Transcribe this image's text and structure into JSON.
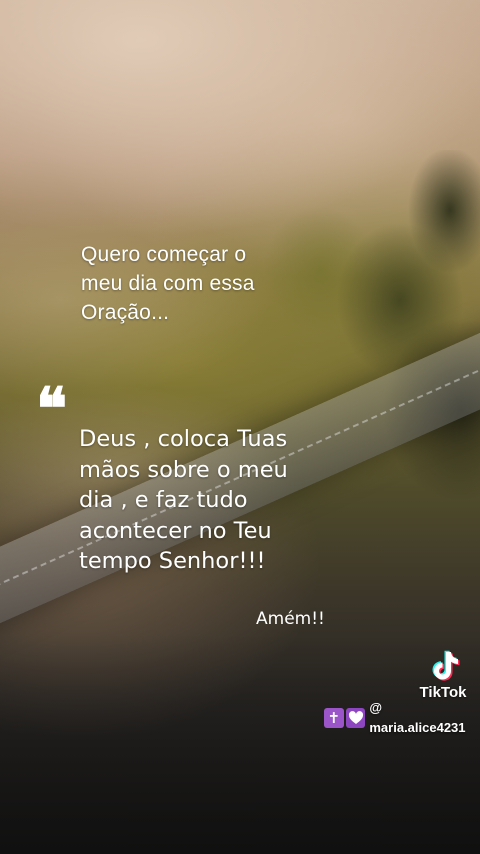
{
  "post": {
    "intro_text": "Quero começar o\nmeu dia com essa\nOração...",
    "quote_mark": "❝",
    "prayer_text": "Deus , coloca Tuas\nmãos sobre o meu\ndia , e faz tudo\nacontecer no Teu\ntempo Senhor!!!",
    "closing_text": "Amém!!"
  },
  "watermark": {
    "logo_icon": "tiktok-note-icon",
    "brand_name": "TikTok",
    "emoji_1": "✝",
    "emoji_2_icon": "heart-icon",
    "username": "@ maria.alice4231"
  },
  "colors": {
    "text": "#ffffff",
    "tiktok_cyan": "#25f4ee",
    "tiktok_red": "#fe2c55",
    "emoji_purple": "#9b55c9"
  }
}
